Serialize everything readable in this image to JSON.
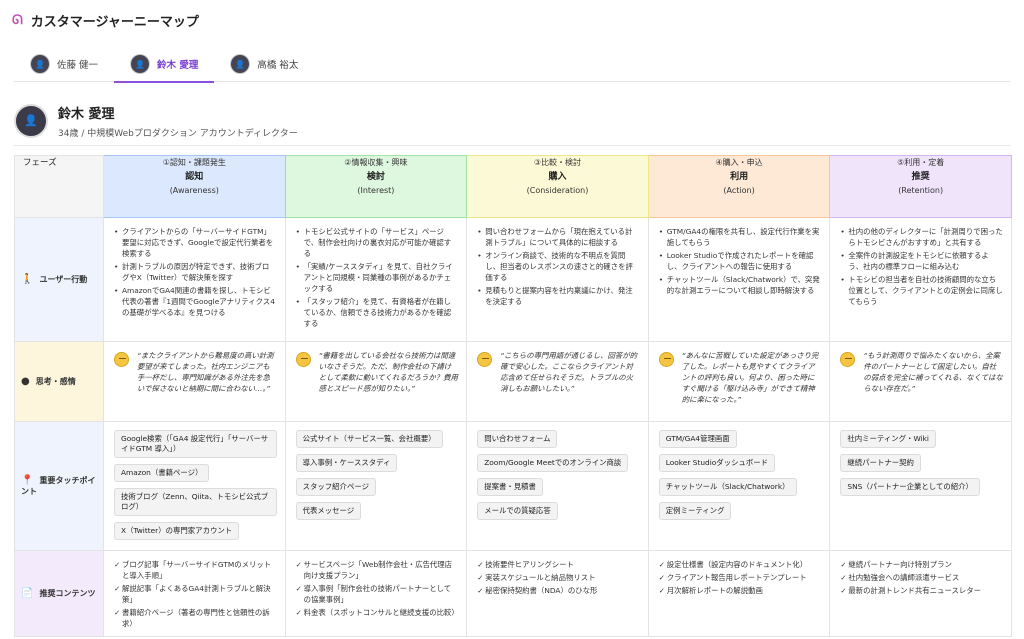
{
  "app": {
    "title": "カスタマージャーニーマップ"
  },
  "tabs": [
    {
      "label": "佐藤 健一",
      "active": false
    },
    {
      "label": "鈴木 愛理",
      "active": true
    },
    {
      "label": "高橋 裕太",
      "active": false
    }
  ],
  "profile": {
    "name": "鈴木 愛理",
    "subtitle": "34歳 / 中規模Webプロダクション アカウントディレクター"
  },
  "corner": "フェーズ",
  "phases": [
    {
      "step": "①認知・課題発生",
      "name": "認知",
      "en": "(Awareness)",
      "bg": "#dbe8fd",
      "border": "#a8c6f5"
    },
    {
      "step": "②情報収集・興味",
      "name": "検討",
      "en": "(Interest)",
      "bg": "#def7df",
      "border": "#a4e3a7"
    },
    {
      "step": "③比較・検討",
      "name": "購入",
      "en": "(Consideration)",
      "bg": "#fcf9d6",
      "border": "#f0e58b"
    },
    {
      "step": "④購入・申込",
      "name": "利用",
      "en": "(Action)",
      "bg": "#fde9d6",
      "border": "#f5c797"
    },
    {
      "step": "⑤利用・定着",
      "name": "推奨",
      "en": "(Retention)",
      "bg": "#f0e4fb",
      "border": "#d2b6f2"
    }
  ],
  "rows": {
    "actions": {
      "label": "ユーザー行動",
      "bg": "#eef3fd",
      "icon": "🚶",
      "cells": [
        [
          "クライアントからの「サーバーサイドGTM」要望に対応できず、Googleで設定代行業者を検索する",
          "計測トラブルの原因が特定できず、技術ブログやX（Twitter）で解決策を探す",
          "AmazonでGA4関連の書籍を探し、トモシビ代表の著書『1週間でGoogleアナリティクス4の基礎が学べる本』を見つける"
        ],
        [
          "トモシビ公式サイトの「サービス」ページで、制作会社向けの裏衣対応が可能か確認する",
          "「実績/ケーススタディ」を見て、自社クライアントと同規模・同業種の事例があるかチェックする",
          "「スタッフ紹介」を見て、有資格者が在籍しているか、信頼できる技術力があるかを確認する"
        ],
        [
          "問い合わせフォームから「現在抱えている計測トラブル」について具体的に相談する",
          "オンライン商談で、技術的な不明点を質問し、担当者のレスポンスの速さと的確さを評価する",
          "見積もりと提案内容を社内稟議にかけ、発注を決定する"
        ],
        [
          "GTM/GA4の権限を共有し、設定代行作業を実施してもらう",
          "Looker Studioで作成されたレポートを確認し、クライアントへの報告に使用する",
          "チャットツール（Slack/Chatwork）で、突発的な計測エラーについて相談し即時解決する"
        ],
        [
          "社内の他のディレクターに「計測周りで困ったらトモシビさんがおすすめ」と共有する",
          "全案件の計測設定をトモシビに依頼するよう、社内の標準フローに組み込む",
          "トモシビの担当者を自社の技術顧問的な立ち位置として、クライアントとの定例会に同席してもらう"
        ]
      ]
    },
    "thoughts": {
      "label": "思考・感情",
      "bg": "#fdf6dc",
      "icon": "●",
      "cells": [
        "“またクライアントから難易度の高い計測要望が来てしまった。社内エンジニアも手一杯だし、専門知識がある外注先を急いで探さないと納期に間に合わない…。”",
        "“書籍を出している会社なら技術力は間違いなさそうだ。ただ、制作会社の下請けとして柔軟に動いてくれるだろうか？費用感とスピード感が知りたい。”",
        "“こちらの専門用語が通じるし、回答が的確で安心した。ここならクライアント対応含めて任せられそうだ。トラブルの火消しもお願いしたい。”",
        "“あんなに苦戦していた設定があっさり完了した。レポートも見やすくてクライアントの評判も良い。何より、困った時にすぐ聞ける「駆け込み寺」ができて精神的に楽になった。”",
        "“もう計測周りで悩みたくないから、全案件のパートナーとして固定したい。自社の弱点を完全に補ってくれる、なくてはならない存在だ。”"
      ]
    },
    "touchpoints": {
      "label": "重要タッチポイント",
      "bg": "#eef3fd",
      "icon": "📍",
      "cells": [
        [
          "Google検索（「GA4 設定代行」「サーバーサイドGTM 導入」）",
          "Amazon（書籍ページ）",
          "技術ブログ（Zenn、Qiita、トモシビ公式ブログ）",
          "X（Twitter）の専門家アカウント"
        ],
        [
          "公式サイト（サービス一覧、会社概要）",
          "導入事例・ケーススタディ",
          "スタッフ紹介ページ",
          "代表メッセージ"
        ],
        [
          "問い合わせフォーム",
          "Zoom/Google Meetでのオンライン商談",
          "提案書・見積書",
          "メールでの質疑応答"
        ],
        [
          "GTM/GA4管理画面",
          "Looker Studioダッシュボード",
          "チャットツール（Slack/Chatwork）",
          "定例ミーティング"
        ],
        [
          "社内ミーティング・Wiki",
          "継続パートナー契約",
          "SNS（パートナー企業としての紹介）"
        ]
      ]
    },
    "content": {
      "label": "推奨コンテンツ",
      "bg": "#f3ebfc",
      "icon": "📄",
      "cells": [
        [
          "ブログ記事「サーバーサイドGTMのメリットと導入手順」",
          "解説記事「よくあるGA4計測トラブルと解決策」",
          "書籍紹介ページ（著者の専門性と信頼性の訴求）"
        ],
        [
          "サービスページ「Web制作会社・広告代理店向け支援プラン」",
          "導入事例「制作会社の技術パートナーとしての協業事例」",
          "料金表（スポットコンサルと継続支援の比較）"
        ],
        [
          "技術要件ヒアリングシート",
          "実装スケジュールと納品物リスト",
          "秘密保持契約書（NDA）のひな形"
        ],
        [
          "設定仕様書（設定内容のドキュメント化）",
          "クライアント報告用レポートテンプレート",
          "月次解析レポートの解説動画"
        ],
        [
          "継続パートナー向け特別プラン",
          "社内勉強会への講師派遣サービス",
          "最新の計測トレンド共有ニュースレター"
        ]
      ]
    }
  }
}
